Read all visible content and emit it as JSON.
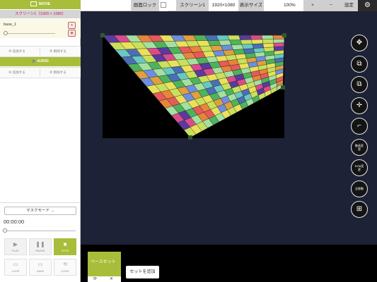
{
  "topbar": {
    "screen_lock": "画面ロック",
    "screen_name": "スクリーン1",
    "resolution": "1920×1080",
    "display_size_label": "表示サイズ",
    "zoom": "100%",
    "plus": "+",
    "minus": "−",
    "settings_label": "設定",
    "gear_icon": "gear-icon"
  },
  "left": {
    "movie_header": "MOVIE",
    "screen_title": "スクリーン1（1920 × 1080）",
    "layer_name": "base_1",
    "add_label": "追加する",
    "delete_label": "削除する",
    "audio_header": "AUDIO",
    "audio_add_label": "追加する",
    "audio_delete_label": "削除する",
    "mask_mode": "マスクモード →",
    "timecode": "00:00:00",
    "play": "PLAY",
    "pause": "PAUSE",
    "stop": "STOP",
    "loop1": "LOOP",
    "save": "SAVE",
    "loop2": "LOOP"
  },
  "tools": [
    {
      "name": "move-tool",
      "icon": "move-arrows-icon",
      "label": ""
    },
    {
      "name": "scale-tool",
      "icon": "scale-icon",
      "label": ""
    },
    {
      "name": "rotate-tool",
      "icon": "rotate-icon",
      "label": ""
    },
    {
      "name": "point-tool",
      "icon": "crosshair-icon",
      "label": ""
    },
    {
      "name": "corner-tool",
      "icon": "corner-icon",
      "label": ""
    },
    {
      "name": "video-change-tool",
      "icon": "",
      "label": "動画変更"
    },
    {
      "name": "rgb-change-tool",
      "icon": "",
      "label": "RGB変更"
    },
    {
      "name": "full-move-tool",
      "icon": "",
      "label": "全移動"
    },
    {
      "name": "fit-tool",
      "icon": "fit-icon",
      "label": ""
    }
  ],
  "bottom": {
    "base_set": "ベースセット",
    "add_set": "セットを追加"
  },
  "colors": {
    "accent": "#a8bd3a",
    "canvas_bg": "#1d2236",
    "checker": [
      "#5b3aa0",
      "#e9e15a",
      "#6ac8c0",
      "#e8843b",
      "#4fb25c",
      "#d94c8a",
      "#6e8fe0",
      "#c9e05c",
      "#e55b5b",
      "#4a6fb5",
      "#a4e0a0",
      "#e0a040"
    ]
  }
}
